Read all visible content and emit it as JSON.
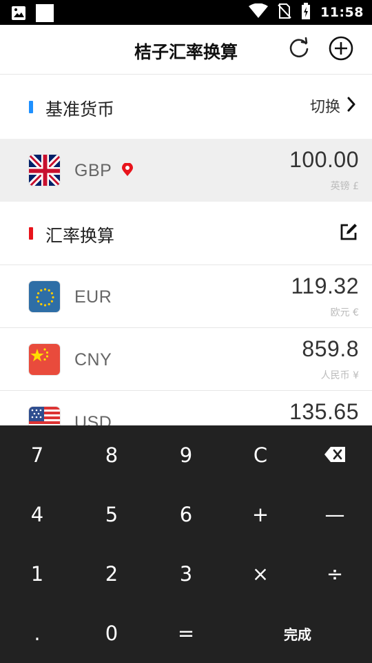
{
  "status_bar": {
    "time": "11:58",
    "icons": [
      "image-notification-icon",
      "white-square-notification-icon",
      "wifi-icon",
      "no-sim-icon",
      "battery-charging-icon"
    ]
  },
  "app_bar": {
    "title": "桔子汇率换算",
    "icons": [
      "refresh-icon",
      "add-circle-icon"
    ]
  },
  "base_section": {
    "title": "基准货币",
    "marker_color": "#1e90ff",
    "switch_label": "切换",
    "switch_icon": "chevron-right-icon"
  },
  "base_currency": {
    "code": "GBP",
    "amount": "100.00",
    "sub": "英镑 £",
    "flag": "uk-flag-icon",
    "location_icon": "location-pin-icon",
    "location_color": "#e8141c"
  },
  "rates_section": {
    "title": "汇率换算",
    "marker_color": "#e8141c",
    "edit_icon": "edit-icon"
  },
  "currencies": [
    {
      "code": "EUR",
      "amount": "119.32",
      "sub": "欧元 €",
      "flag": "eu-flag-icon"
    },
    {
      "code": "CNY",
      "amount": "859.8",
      "sub": "人民币 ¥",
      "flag": "china-flag-icon"
    },
    {
      "code": "USD",
      "amount": "135.65",
      "sub": "",
      "flag": "us-flag-icon"
    }
  ],
  "keypad": {
    "background": "#222222",
    "rows": [
      [
        "7",
        "8",
        "9",
        "C",
        "⌫"
      ],
      [
        "4",
        "5",
        "6",
        "+",
        "—"
      ],
      [
        "1",
        "2",
        "3",
        "×",
        "÷"
      ],
      [
        ".",
        "0",
        "=",
        "完成"
      ]
    ],
    "backspace_icon": "backspace-icon"
  }
}
